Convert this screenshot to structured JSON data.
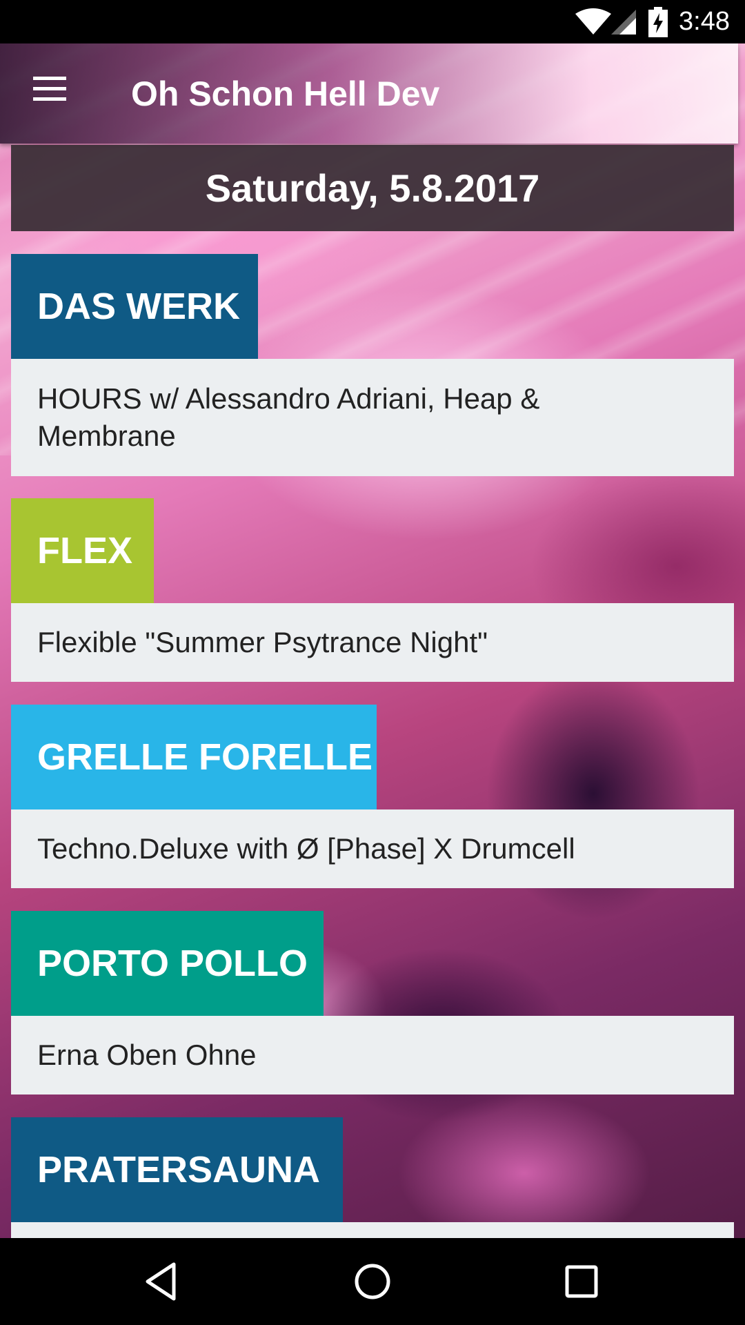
{
  "status_bar": {
    "time": "3:48",
    "icons": [
      "wifi-icon",
      "cell-signal-icon",
      "battery-charging-icon"
    ]
  },
  "app_bar": {
    "title": "Oh Schon Hell Dev",
    "menu_icon": "hamburger-menu-icon"
  },
  "date_header": "Saturday, 5.8.2017",
  "venues": [
    {
      "name": "DAS WERK",
      "color": "#0f5a85",
      "event_line1": "HOURS w/ Alessandro Adriani, Heap &",
      "event_line2": "Membrane"
    },
    {
      "name": "FLEX",
      "color": "#a8c531",
      "event": "Flexible \"Summer Psytrance Night\""
    },
    {
      "name": "GRELLE FORELLE",
      "color": "#29b5e8",
      "event": "Techno.Deluxe with Ø [Phase] X Drumcell"
    },
    {
      "name": "PORTO POLLO",
      "color": "#009e8a",
      "event": "Erna Oben Ohne"
    },
    {
      "name": "PRATERSAUNA",
      "color": "#0f5a85"
    }
  ],
  "nav_bar": {
    "back_icon": "back-triangle-icon",
    "home_icon": "home-circle-icon",
    "recents_icon": "recents-square-icon"
  }
}
